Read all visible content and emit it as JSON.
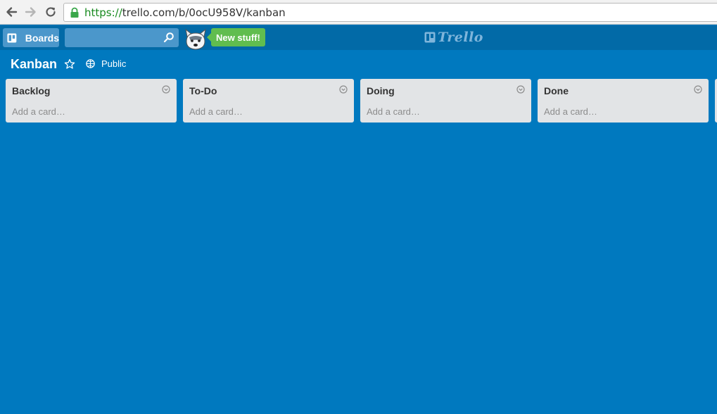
{
  "browser": {
    "url_scheme": "https://",
    "url_rest": "trello.com/b/0ocU958V/kanban"
  },
  "header": {
    "boards_label": "Boards",
    "search_value": "",
    "new_stuff_label": "New stuff!",
    "logo_text": "Trello"
  },
  "board": {
    "title": "Kanban",
    "visibility": "Public"
  },
  "lists": [
    {
      "title": "Backlog",
      "add_card": "Add a card…"
    },
    {
      "title": "To-Do",
      "add_card": "Add a card…"
    },
    {
      "title": "Doing",
      "add_card": "Add a card…"
    },
    {
      "title": "Done",
      "add_card": "Add a card…"
    }
  ],
  "colors": {
    "board_background": "#0079bf",
    "header_background": "#026aa7",
    "header_button": "#4b97cb",
    "new_stuff": "#61bd4f",
    "list_background": "#e2e4e6"
  }
}
